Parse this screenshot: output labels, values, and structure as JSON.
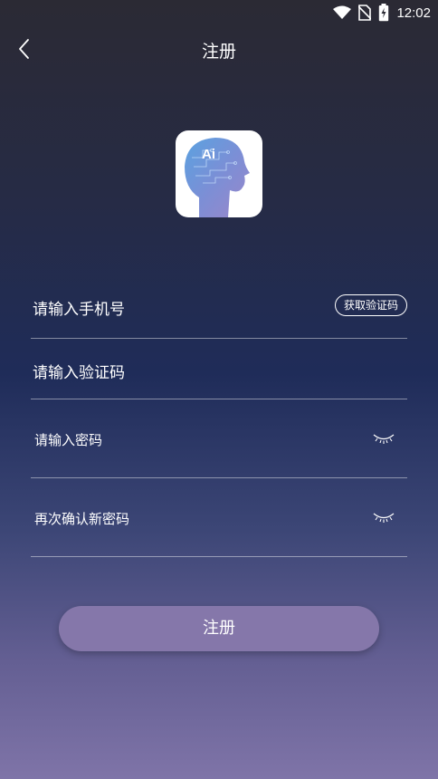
{
  "status_bar": {
    "time": "12:02",
    "icons": [
      "wifi-icon",
      "no-sim-icon",
      "battery-charging-icon"
    ]
  },
  "header": {
    "title": "注册",
    "back_icon": "chevron-left-icon"
  },
  "logo": {
    "text": "Ai",
    "icon": "ai-head-logo"
  },
  "form": {
    "phone_placeholder": "请输入手机号",
    "get_code_label": "获取验证码",
    "code_placeholder": "请输入验证码",
    "password_placeholder": "请输入密码",
    "confirm_password_placeholder": "再次确认新密码",
    "toggle_icon": "closed-eye-icon"
  },
  "submit": {
    "label": "注册"
  },
  "colors": {
    "button_bg": "#8577aa",
    "bg_top": "#2b2a34",
    "bg_bottom": "#7f74a8"
  }
}
